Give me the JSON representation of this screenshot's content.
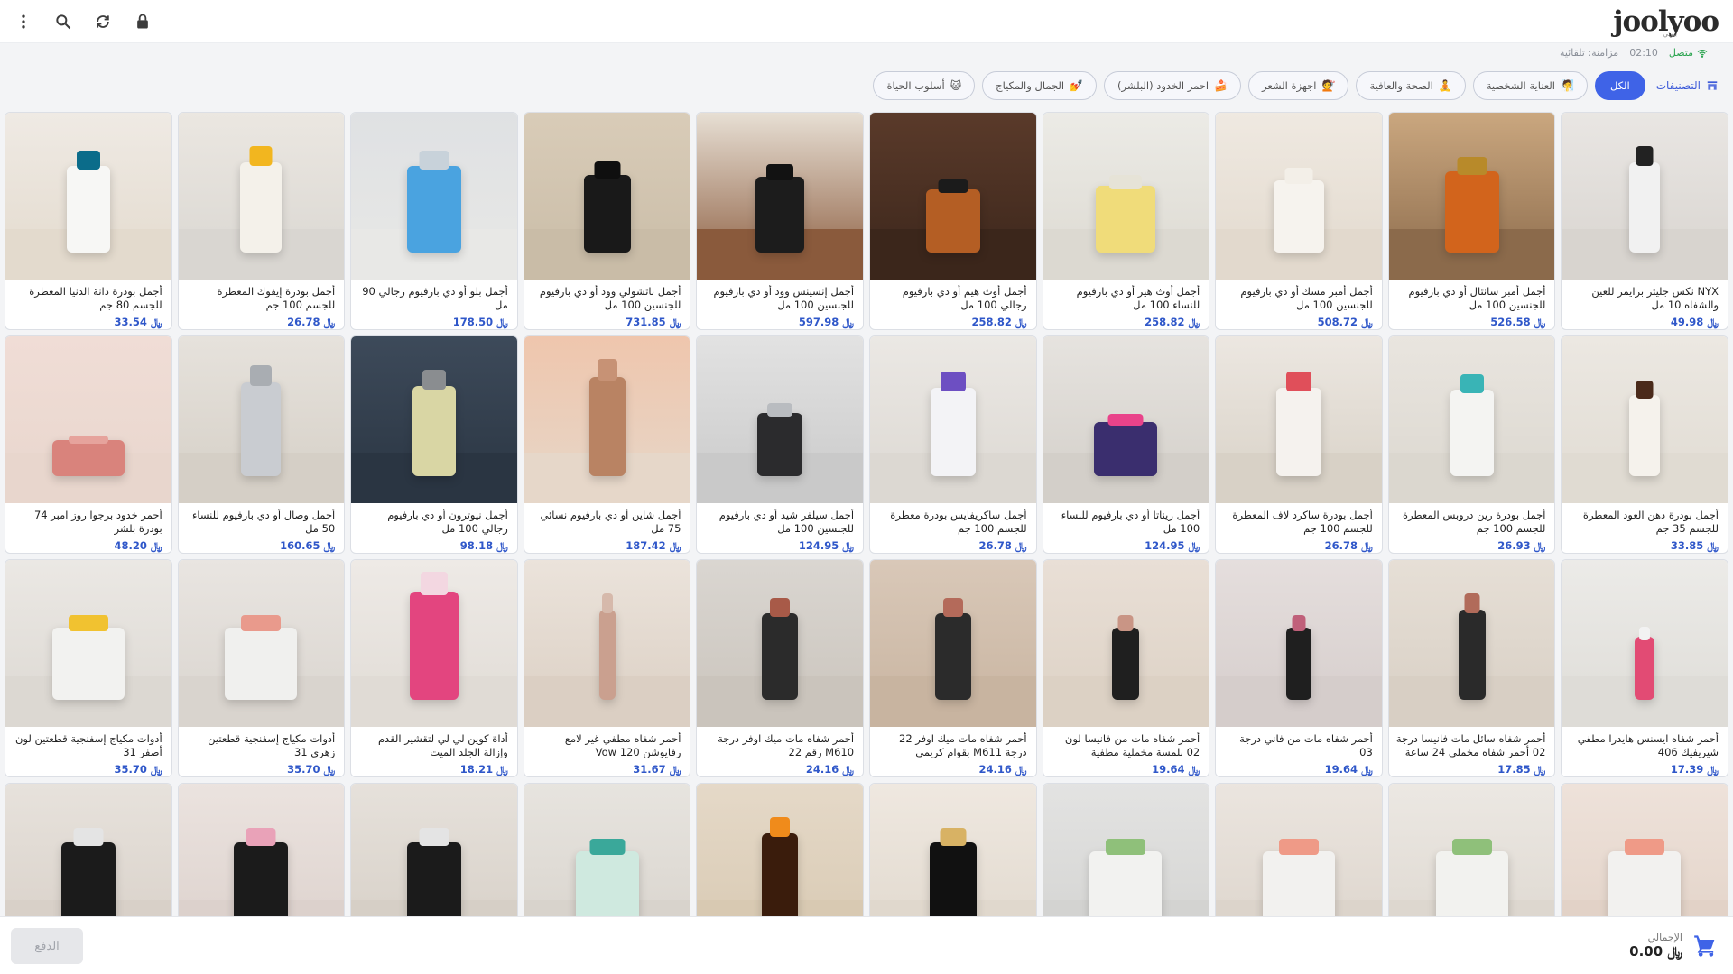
{
  "app": {
    "logo": "joolyoo",
    "logo_sub": "بيوتي"
  },
  "toolbar": {
    "icons": [
      "lock-icon",
      "sync-icon",
      "search-icon",
      "more-vert-icon"
    ]
  },
  "status": {
    "online": "متصل",
    "time": "02:10",
    "sync": "مزامنة: تلقائية"
  },
  "categories": {
    "title": "التصنيفات",
    "items": [
      {
        "label": "الكل",
        "emoji": "",
        "active": true
      },
      {
        "label": "العناية الشخصية",
        "emoji": "🧖",
        "active": false
      },
      {
        "label": "الصحة والعافية",
        "emoji": "🧘",
        "active": false
      },
      {
        "label": "اجهزة الشعر",
        "emoji": "💇",
        "active": false
      },
      {
        "label": "احمر الخدود (البلشر)",
        "emoji": "🍰",
        "active": false
      },
      {
        "label": "الجمال والمكياج",
        "emoji": "💅",
        "active": false
      },
      {
        "label": "أسلوب الحياة",
        "emoji": "😺",
        "active": false
      }
    ]
  },
  "currency": "﷼",
  "products": [
    {
      "name": "NYX نكس جليتر برايمر للعين والشفاه 10 مل",
      "price": "49.98",
      "bg": "#e9e6e3",
      "counter": "#d8d4cf",
      "obj": "#f1f1f1",
      "cap": "#222",
      "w": 34,
      "h": 100
    },
    {
      "name": "أجمل أمبر سانتال أو دي بارفيوم للجنسين 100 مل",
      "price": "526.58",
      "bg": "#caa77f",
      "counter": "#8b6a4b",
      "obj": "#d2641c",
      "cap": "#b88a2a",
      "w": 60,
      "h": 90
    },
    {
      "name": "أجمل أمبر مسك أو دي بارفيوم للجنسين 100 مل",
      "price": "508.72",
      "bg": "#efe9e1",
      "counter": "#e2d9cd",
      "obj": "#f6f3ee",
      "cap": "#f3efe8",
      "w": 56,
      "h": 80
    },
    {
      "name": "أجمل أوث هير أو دي بارفيوم للنساء 100 مل",
      "price": "258.82",
      "bg": "#ecebe6",
      "counter": "#dcd9d1",
      "obj": "#f0dc7a",
      "cap": "#e6e3d7",
      "w": 66,
      "h": 74
    },
    {
      "name": "أجمل أوث هيم أو دي بارفيوم رجالي 100 مل",
      "price": "258.82",
      "bg": "#5a3a2a",
      "counter": "#3b261b",
      "obj": "#b45e24",
      "cap": "#1b1b1b",
      "w": 60,
      "h": 70
    },
    {
      "name": "أجمل إنسينس وود أو دي بارفيوم للجنسين 100 مل",
      "price": "597.98",
      "bg": "#e7dfd4",
      "counter": "#8a5a3c",
      "obj": "#1c1c1c",
      "cap": "#121212",
      "w": 54,
      "h": 84
    },
    {
      "name": "أجمل باتشولي وود أو دي بارفيوم للجنسين 100 مل",
      "price": "731.85",
      "bg": "#d9ccb8",
      "counter": "#c9bca7",
      "obj": "#191919",
      "cap": "#0f0f0f",
      "w": 52,
      "h": 86
    },
    {
      "name": "أجمل بلو أو دي بارفيوم رجالي 90 مل",
      "price": "178.50",
      "bg": "#dfe1e3",
      "counter": "#e8e8e6",
      "obj": "#4aa3e0",
      "cap": "#c8d2da",
      "w": 60,
      "h": 96
    },
    {
      "name": "أجمل بودرة إيفوك المعطرة للجسم 100 جم",
      "price": "26.78",
      "bg": "#ebe7e1",
      "counter": "#d9d6d1",
      "obj": "#f4f1ea",
      "cap": "#f2b61f",
      "w": 46,
      "h": 100
    },
    {
      "name": "أجمل بودرة دانة الدنيا المعطرة للجسم 80 جم",
      "price": "33.54",
      "bg": "#efeae4",
      "counter": "#e3dacd",
      "obj": "#f7f7f5",
      "cap": "#0b6c8a",
      "w": 48,
      "h": 96
    },
    {
      "name": "أجمل بودرة دهن العود المعطرة للجسم 35 جم",
      "price": "33.85",
      "bg": "#ece8e2",
      "counter": "#e0dbd2",
      "obj": "#f5f2ec",
      "cap": "#4a2a1a",
      "w": 34,
      "h": 90
    },
    {
      "name": "أجمل بودرة رين دروبس المعطرة للجسم 100 جم",
      "price": "26.93",
      "bg": "#e9e5df",
      "counter": "#dbd7cf",
      "obj": "#f4f4f2",
      "cap": "#39b4b6",
      "w": 48,
      "h": 96
    },
    {
      "name": "أجمل بودرة ساكرد لاف المعطرة للجسم 100 جم",
      "price": "26.78",
      "bg": "#ece7e1",
      "counter": "#d8d1c6",
      "obj": "#f5f2ee",
      "cap": "#e04f5a",
      "w": 50,
      "h": 98
    },
    {
      "name": "أجمل ريناتا أو دي بارفيوم للنساء 100 مل",
      "price": "124.95",
      "bg": "#e6e3df",
      "counter": "#d3cfc9",
      "obj": "#3a2e6e",
      "cap": "#e9438a",
      "w": 70,
      "h": 60
    },
    {
      "name": "أجمل ساكريفايس بودرة معطرة للجسم 100 جم",
      "price": "26.78",
      "bg": "#ebe8e4",
      "counter": "#dcd8d2",
      "obj": "#f3f3f6",
      "cap": "#6d4fc2",
      "w": 50,
      "h": 98
    },
    {
      "name": "أجمل سيلفر شيد أو دي بارفيوم للجنسين 100 مل",
      "price": "124.95",
      "bg": "#e2e2e2",
      "counter": "#c9c9c9",
      "obj": "#2b2b2d",
      "cap": "#b9bcc0",
      "w": 50,
      "h": 70
    },
    {
      "name": "أجمل شاين أو دي بارفيوم نسائي 75 مل",
      "price": "187.42",
      "bg": "#efc6ad",
      "counter": "#e6d7c9",
      "obj": "#b98363",
      "cap": "#c79275",
      "w": 40,
      "h": 110
    },
    {
      "name": "أجمل نيوترون أو دي بارفيوم رجالي 100 مل",
      "price": "98.18",
      "bg": "#3d4a5a",
      "counter": "#2a3542",
      "obj": "#d9d6a4",
      "cap": "#8a8d90",
      "w": 48,
      "h": 100
    },
    {
      "name": "أجمل وصال أو دي بارفيوم للنساء 50 مل",
      "price": "160.65",
      "bg": "#e6e2dc",
      "counter": "#d5cfc6",
      "obj": "#c9ccd1",
      "cap": "#a9adb2",
      "w": 44,
      "h": 104
    },
    {
      "name": "أحمر خدود برجوا روز امبر 74 بودرة بلشر",
      "price": "48.20",
      "bg": "#f0ddd6",
      "counter": "#e8d6cd",
      "obj": "#d9837c",
      "cap": "#e6a39c",
      "w": 80,
      "h": 40
    },
    {
      "name": "أحمر شفاه ايسنس هايدرا مطفي شيريفيك 406",
      "price": "17.39",
      "bg": "#ecebe8",
      "counter": "#dedcd7",
      "obj": "#e24b74",
      "cap": "#f2f2f2",
      "w": 22,
      "h": 70
    },
    {
      "name": "أحمر شفاه سائل مات فانيسا درجة 02 أحمر شفاه مخملي 24 ساعة",
      "price": "17.85",
      "bg": "#e6dfd6",
      "counter": "#d8cfc4",
      "obj": "#2a2a2a",
      "cap": "#b16b5a",
      "w": 30,
      "h": 100
    },
    {
      "name": "أحمر شفاه مات من فاني درجة 03",
      "price": "19.64",
      "bg": "#e5dedd",
      "counter": "#d5cdcb",
      "obj": "#1f1f1f",
      "cap": "#c0607a",
      "w": 28,
      "h": 80
    },
    {
      "name": "أحمر شفاه مات من فانيسا لون 02 بلمسة مخملية مطفية",
      "price": "19.64",
      "bg": "#e9dfd6",
      "counter": "#dcd1c4",
      "obj": "#1f1f1f",
      "cap": "#c99585",
      "w": 30,
      "h": 80
    },
    {
      "name": "أحمر شفاه مات ميك اوفر 22 درجة M611 بقوام كريمي",
      "price": "24.16",
      "bg": "#d9c8b8",
      "counter": "#c8b4a0",
      "obj": "#2b2b2b",
      "cap": "#b46a5a",
      "w": 40,
      "h": 96
    },
    {
      "name": "أحمر شفاه مات ميك اوفر درجة M610 رقم 22",
      "price": "24.16",
      "bg": "#dad6d1",
      "counter": "#cac4bc",
      "obj": "#2b2b2b",
      "cap": "#a85a48",
      "w": 40,
      "h": 96
    },
    {
      "name": "أحمر شفاه مطفي غير لامع رفايوشن Vow 120",
      "price": "31.67",
      "bg": "#ebe3db",
      "counter": "#dbcfc3",
      "obj": "#caa08f",
      "cap": "#d6b9ab",
      "w": 18,
      "h": 100
    },
    {
      "name": "أداة كوين لي لي لتقشير القدم وإزالة الجلد الميت",
      "price": "18.21",
      "bg": "#eeeae6",
      "counter": "#e0dbd5",
      "obj": "#e3457f",
      "cap": "#f3d7e1",
      "w": 54,
      "h": 120
    },
    {
      "name": "أدوات مكياج إسفنجية قطعتين زهري 31",
      "price": "35.70",
      "bg": "#e9e5e1",
      "counter": "#d9d4ce",
      "obj": "#f0f0ee",
      "cap": "#e99a8c",
      "w": 80,
      "h": 80
    },
    {
      "name": "أدوات مكياج إسفنجية قطعتين لون أصفر 31",
      "price": "35.70",
      "bg": "#ebe8e4",
      "counter": "#dcd8d2",
      "obj": "#f2f2f0",
      "cap": "#f1c230",
      "w": 80,
      "h": 80
    },
    {
      "name": "",
      "price": "",
      "bg": "#eee2da",
      "counter": "#e2d2c7",
      "obj": "#f2f1ef",
      "cap": "#ef9a87",
      "w": 80,
      "h": 80
    },
    {
      "name": "",
      "price": "",
      "bg": "#ece8e3",
      "counter": "#ddd7cf",
      "obj": "#f2f2ef",
      "cap": "#8fc07a",
      "w": 80,
      "h": 80
    },
    {
      "name": "",
      "price": "",
      "bg": "#ebe5df",
      "counter": "#dcd4cb",
      "obj": "#f2f1ef",
      "cap": "#ef9a87",
      "w": 80,
      "h": 80
    },
    {
      "name": "",
      "price": "",
      "bg": "#e3e3e2",
      "counter": "#d3d3d1",
      "obj": "#f2f2f0",
      "cap": "#8fc07a",
      "w": 80,
      "h": 80
    },
    {
      "name": "",
      "price": "",
      "bg": "#efe8e0",
      "counter": "#e0d8cd",
      "obj": "#111111",
      "cap": "#d8b264",
      "w": 52,
      "h": 90
    },
    {
      "name": "",
      "price": "",
      "bg": "#e5d9c8",
      "counter": "#d8c9b2",
      "obj": "#3a1c0c",
      "cap": "#f08b1b",
      "w": 40,
      "h": 100
    },
    {
      "name": "",
      "price": "",
      "bg": "#e7e4df",
      "counter": "#d8d3cc",
      "obj": "#cfe9df",
      "cap": "#3aa89a",
      "w": 70,
      "h": 80
    },
    {
      "name": "",
      "price": "",
      "bg": "#e6e1db",
      "counter": "#d6cfc6",
      "obj": "#1b1b1b",
      "cap": "#e4e4e4",
      "w": 60,
      "h": 90
    },
    {
      "name": "",
      "price": "",
      "bg": "#ebe3df",
      "counter": "#dcd1cc",
      "obj": "#1b1b1b",
      "cap": "#e9a2b8",
      "w": 60,
      "h": 90
    },
    {
      "name": "",
      "price": "",
      "bg": "#e7e2dc",
      "counter": "#d8d0c8",
      "obj": "#1b1b1b",
      "cap": "#e4e4e4",
      "w": 60,
      "h": 90
    }
  ],
  "footer": {
    "total_label": "الإجمالي",
    "total_value": "0.00",
    "pay_label": "الدفع"
  }
}
